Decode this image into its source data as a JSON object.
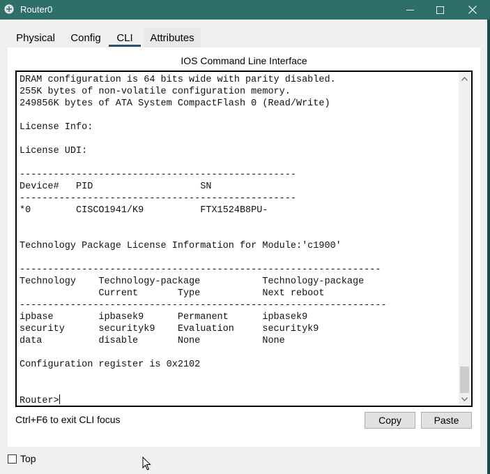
{
  "window": {
    "title": "Router0",
    "controls": [
      "minimize",
      "maximize",
      "close"
    ]
  },
  "tabs": [
    {
      "label": "Physical",
      "selected": false
    },
    {
      "label": "Config",
      "selected": false
    },
    {
      "label": "CLI",
      "selected": true
    },
    {
      "label": "Attributes",
      "selected": false
    }
  ],
  "cli": {
    "header": "IOS Command Line Interface",
    "output": "DRAM configuration is 64 bits wide with parity disabled.\n255K bytes of non-volatile configuration memory.\n249856K bytes of ATA System CompactFlash 0 (Read/Write)\n\nLicense Info:\n\nLicense UDI:\n\n-------------------------------------------------\nDevice#   PID                   SN\n-------------------------------------------------\n*0        CISCO1941/K9          FTX1524B8PU-\n\n\nTechnology Package License Information for Module:'c1900'\n\n----------------------------------------------------------------\nTechnology    Technology-package           Technology-package\n              Current       Type           Next reboot\n-----------------------------------------------------------------\nipbase        ipbasek9      Permanent      ipbasek9\nsecurity      securityk9    Evaluation     securityk9\ndata          disable       None           None\n\nConfiguration register is 0x2102\n\n\nRouter>"
  },
  "footer": {
    "hint": "Ctrl+F6 to exit CLI focus",
    "copy_label": "Copy",
    "paste_label": "Paste"
  },
  "bottom": {
    "top_label": "Top",
    "top_checked": false
  },
  "colors": {
    "titlebar": "#2f6f6a",
    "tab_underline": "#2c4f66"
  }
}
